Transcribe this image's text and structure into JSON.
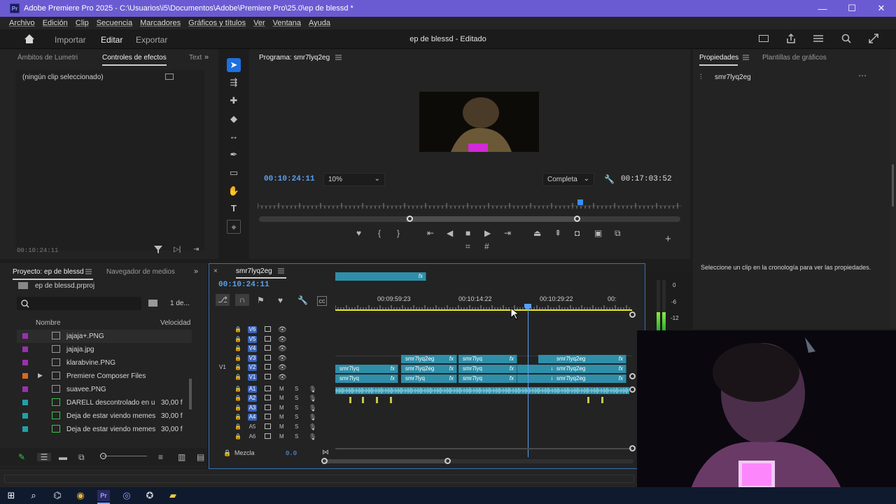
{
  "window": {
    "title": "Adobe Premiere Pro 2025 - C:\\Usuarios\\i5\\Documentos\\Adobe\\Premiere Pro\\25.0\\ep de blessd *",
    "app_badge": "Pr",
    "minimize": "—",
    "maximize": "☐",
    "close": "✕"
  },
  "menu": [
    "Archivo",
    "Edición",
    "Clip",
    "Secuencia",
    "Marcadores",
    "Gráficos y títulos",
    "Ver",
    "Ventana",
    "Ayuda"
  ],
  "workspaces": {
    "import": "Importar",
    "edit": "Editar",
    "export": "Exportar",
    "document": "ep de blessd - Editado"
  },
  "effects_panel": {
    "tabs": [
      "Ámbitos de Lumetri",
      "Controles de efectos",
      "Text"
    ],
    "empty_label": "(ningún clip seleccionado)",
    "timecode": "00:10:24:11"
  },
  "program_monitor": {
    "title": "Programa: smr7lyq2eg",
    "timecode": "00:10:24:11",
    "zoom": "10%",
    "quality": "Completa",
    "duration": "00:17:03:52"
  },
  "properties": {
    "tabs": [
      "Propiedades",
      "Plantillas de gráficos"
    ],
    "item": "smr7lyq2eg",
    "hint": "Seleccione un clip en la cronología para ver las propiedades."
  },
  "project_panel": {
    "tabs": [
      "Proyecto: ep de blessd",
      "Navegador de medios"
    ],
    "file": "ep de blessd.prproj",
    "count": "1 de...",
    "col_name": "Nombre",
    "col_speed": "Velocidad",
    "items": [
      {
        "name": "jajaja+.PNG",
        "fps": "",
        "color": "#9b2fb0"
      },
      {
        "name": "jajaja.jpg",
        "fps": "",
        "color": "#9b2fb0"
      },
      {
        "name": "klarabvine.PNG",
        "fps": "",
        "color": "#9b2fb0"
      },
      {
        "name": "Premiere Composer Files",
        "fps": "",
        "color": "#d46a1e"
      },
      {
        "name": "suavee.PNG",
        "fps": "",
        "color": "#9b2fb0"
      },
      {
        "name": "DARELL descontrolado en u",
        "fps": "30,00 f",
        "color": "#1fa0a8"
      },
      {
        "name": "Deja de estar viendo memes",
        "fps": "30,00 f",
        "color": "#1fa0a8"
      },
      {
        "name": "Deja de estar viendo memes",
        "fps": "30,00 f",
        "color": "#1fa0a8"
      }
    ]
  },
  "timeline": {
    "sequence": "smr7lyq2eg",
    "timecode": "00:10:24:11",
    "ruler": [
      "00:09:59:23",
      "00:10:14:22",
      "00:10:29:22",
      "00:"
    ],
    "video_tracks": [
      "V6",
      "V5",
      "V4",
      "V3",
      "V2",
      "V1"
    ],
    "audio_tracks": [
      "A1",
      "A2",
      "A3",
      "A4",
      "A5",
      "A6"
    ],
    "source_patch": "V1",
    "mix_label": "Mezcla",
    "mix_value": "0.0",
    "clip_labels": [
      "smr7lyq2eg",
      "smr7lyq",
      "smr7lyq",
      "smr7lyq2eg",
      "smr7lyq2eg",
      "smr7lyq",
      "smr7lyq",
      "smr7lyq2eg",
      "smr7lyq2eg",
      "smr7lyq",
      "smr7lyq2eg",
      "smr7lyq2eg"
    ],
    "fx": "fx"
  },
  "audio_meter": {
    "scale": [
      "0",
      "-6",
      "-12"
    ]
  },
  "colors": {
    "accent": "#6a5bd2",
    "clip": "#2f8ea8",
    "timecode": "#5aa0f0",
    "workarea": "#e6e62a"
  }
}
